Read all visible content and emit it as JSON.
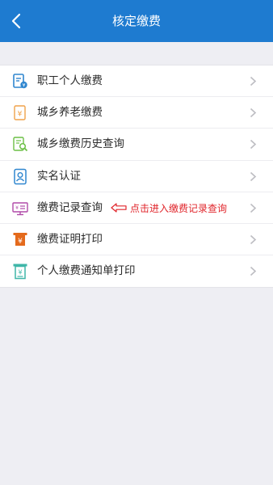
{
  "header": {
    "title": "核定缴费",
    "back_icon": "chevron-left-icon",
    "color": "#1e7bd0"
  },
  "menu": {
    "items": [
      {
        "label": "职工个人缴费",
        "icon": "employee-payment-icon",
        "icon_color": "#2f86cf"
      },
      {
        "label": "城乡养老缴费",
        "icon": "pension-payment-icon",
        "icon_color": "#f0a24a"
      },
      {
        "label": "城乡缴费历史查询",
        "icon": "history-query-icon",
        "icon_color": "#6bbf45"
      },
      {
        "label": "实名认证",
        "icon": "id-card-icon",
        "icon_color": "#2f86cf"
      },
      {
        "label": "缴费记录查询",
        "icon": "payment-record-icon",
        "icon_color": "#b04aa8"
      },
      {
        "label": "缴费证明打印",
        "icon": "certificate-print-icon",
        "icon_color": "#e46a1c"
      },
      {
        "label": "个人缴费通知单打印",
        "icon": "notice-print-icon",
        "icon_color": "#3fb6a8"
      }
    ]
  },
  "annotation": {
    "text": "点击进入缴费记录查询",
    "color": "#e0252b"
  }
}
